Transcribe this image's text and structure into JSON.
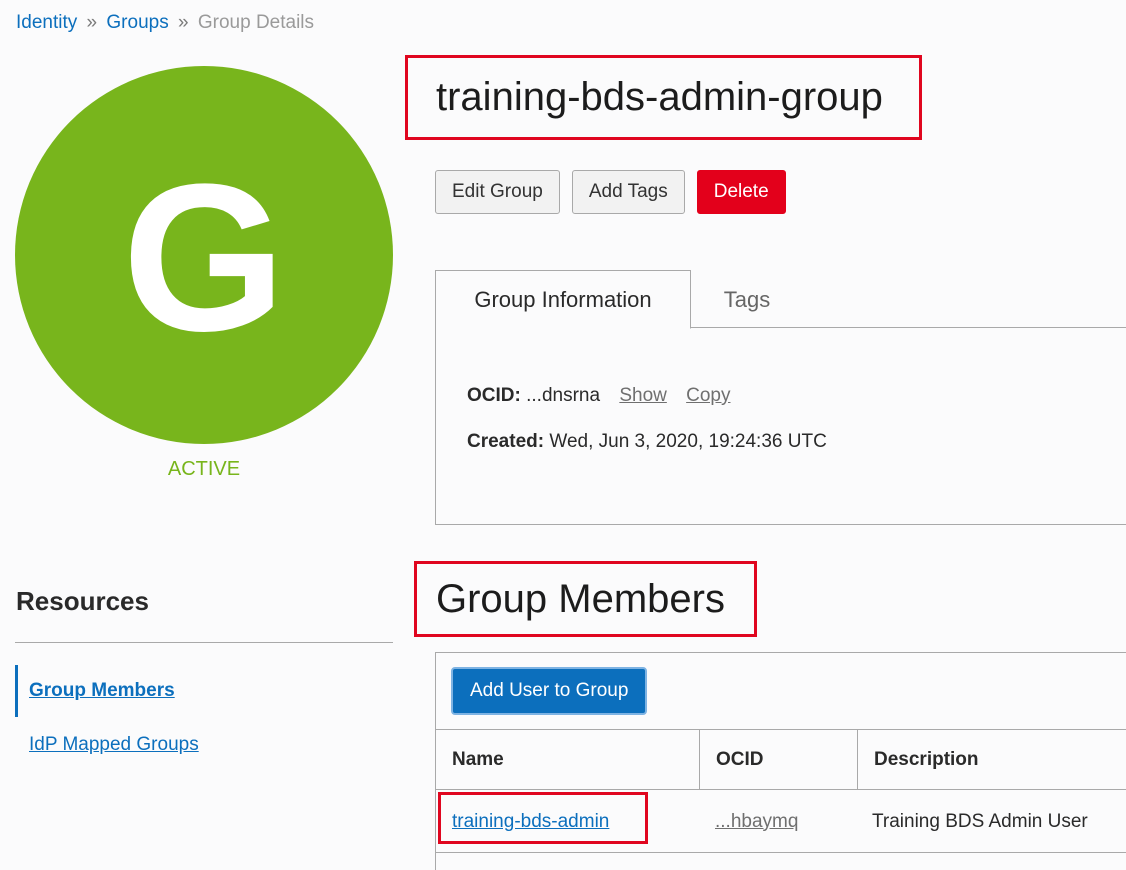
{
  "breadcrumb": {
    "items": [
      "Identity",
      "Groups"
    ],
    "separator": "»",
    "current": "Group Details"
  },
  "avatar": {
    "letter": "G",
    "color": "#78b51c"
  },
  "status": "ACTIVE",
  "title": "training-bds-admin-group",
  "actions": {
    "edit": "Edit Group",
    "add_tags": "Add Tags",
    "delete": "Delete"
  },
  "tabs": [
    {
      "label": "Group Information",
      "active": true
    },
    {
      "label": "Tags",
      "active": false
    }
  ],
  "info": {
    "ocid_label": "OCID:",
    "ocid_value": "...dnsrna",
    "show": "Show",
    "copy": "Copy",
    "created_label": "Created:",
    "created_value": "Wed, Jun 3, 2020, 19:24:36 UTC"
  },
  "resources": {
    "title": "Resources",
    "items": [
      {
        "label": "Group Members",
        "active": true
      },
      {
        "label": "IdP Mapped Groups",
        "active": false
      }
    ]
  },
  "members": {
    "title": "Group Members",
    "add_button": "Add User to Group",
    "columns": [
      "Name",
      "OCID",
      "Description"
    ],
    "rows": [
      {
        "name": "training-bds-admin",
        "ocid": "...hbaymq",
        "description": "Training BDS Admin User"
      }
    ]
  },
  "colors": {
    "accent": "#0c6fbd",
    "danger": "#e3001b",
    "active_status": "#78b51c",
    "highlight": "#e0061f"
  }
}
